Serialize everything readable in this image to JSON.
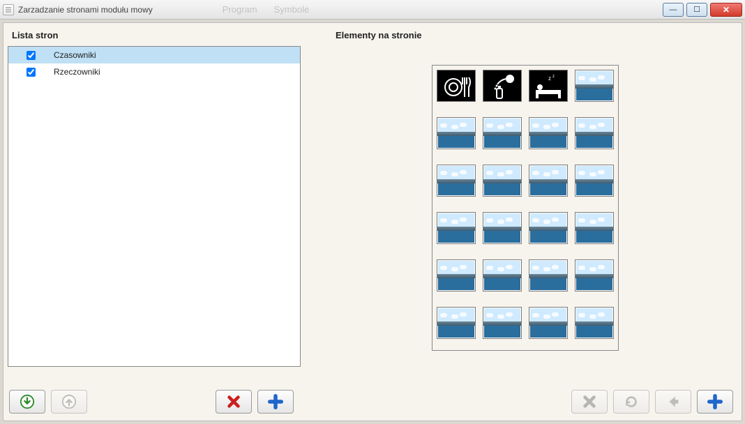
{
  "window_title": "Zarzadzanie stronami modułu mowy",
  "ghost_menu": [
    "Program",
    "Symbole"
  ],
  "left_panel": {
    "title": "Lista stron",
    "rows": [
      {
        "label": "Czasowniki",
        "checked": true,
        "selected": true
      },
      {
        "label": "Rzeczowniki",
        "checked": true,
        "selected": false
      }
    ]
  },
  "right_panel": {
    "title": "Elementy na stronie",
    "cols": 4,
    "items": [
      {
        "kind": "icon",
        "icon": "eat"
      },
      {
        "kind": "icon",
        "icon": "drink"
      },
      {
        "kind": "icon",
        "icon": "sleep"
      },
      {
        "kind": "photo"
      },
      {
        "kind": "photo"
      },
      {
        "kind": "photo"
      },
      {
        "kind": "photo"
      },
      {
        "kind": "photo"
      },
      {
        "kind": "photo"
      },
      {
        "kind": "photo"
      },
      {
        "kind": "photo"
      },
      {
        "kind": "photo"
      },
      {
        "kind": "photo"
      },
      {
        "kind": "photo"
      },
      {
        "kind": "photo"
      },
      {
        "kind": "photo"
      },
      {
        "kind": "photo"
      },
      {
        "kind": "photo"
      },
      {
        "kind": "photo"
      },
      {
        "kind": "photo"
      },
      {
        "kind": "photo"
      },
      {
        "kind": "photo"
      },
      {
        "kind": "photo"
      },
      {
        "kind": "photo"
      }
    ]
  },
  "buttons": {
    "move_down": {
      "enabled": true
    },
    "move_up": {
      "enabled": false
    },
    "delete_page": {
      "enabled": true
    },
    "add_page": {
      "enabled": true
    },
    "delete_element": {
      "enabled": false
    },
    "refresh": {
      "enabled": false
    },
    "back": {
      "enabled": false
    },
    "add_element": {
      "enabled": true
    }
  }
}
